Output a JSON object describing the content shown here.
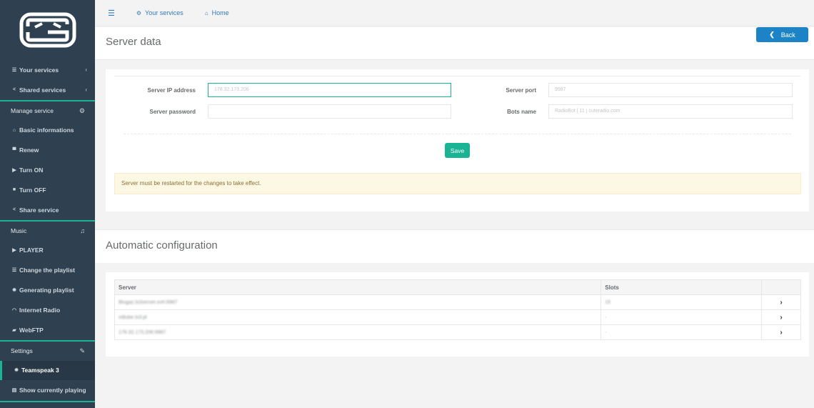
{
  "sidebar": {
    "items": [
      {
        "label": "Your services",
        "icon": "list-icon",
        "chevron": "‹"
      },
      {
        "label": "Shared services",
        "icon": "share-icon",
        "chevron": "‹"
      }
    ],
    "manage": {
      "header": "Manage service",
      "items": [
        {
          "label": "Basic informations",
          "icon": "home-icon"
        },
        {
          "label": "Renew",
          "icon": "cart-icon"
        },
        {
          "label": "Turn ON",
          "icon": "play-icon"
        },
        {
          "label": "Turn OFF",
          "icon": "stop-icon"
        },
        {
          "label": "Share service",
          "icon": "share-icon"
        }
      ]
    },
    "music": {
      "header": "Music",
      "items": [
        {
          "label": "PLAYER",
          "icon": "play-icon"
        },
        {
          "label": "Change the playlist",
          "icon": "list-icon"
        },
        {
          "label": "Generating playlist",
          "icon": "gear-icon"
        },
        {
          "label": "Internet Radio",
          "icon": "rss-icon"
        },
        {
          "label": "WebFTP",
          "icon": "folder-icon"
        }
      ]
    },
    "settings": {
      "header": "Settings",
      "items": [
        {
          "label": "Teamspeak 3",
          "icon": "gear-icon"
        },
        {
          "label": "Show currently playing",
          "icon": "file-icon"
        }
      ]
    }
  },
  "topbar": {
    "services": "Your services",
    "home": "Home"
  },
  "server_data": {
    "title": "Server data",
    "back": "Back",
    "ip_label": "Server IP address",
    "ip_value": "178.32.173.206",
    "port_label": "Server port",
    "port_value": "9987",
    "password_label": "Server password",
    "password_value": "",
    "bots_label": "Bots name",
    "bots_value": "RadioBot | 11 | cuteradio.com",
    "save": "Save",
    "alert": "Server must be restarted for the changes to take effect."
  },
  "auto_config": {
    "title": "Automatic configuration",
    "columns": [
      "Server",
      "Slots",
      ""
    ],
    "rows": [
      {
        "server": "Blugaz.ts3server.ovh:9987",
        "slots": "15"
      },
      {
        "server": "vdtube.ts3.pl",
        "slots": "-"
      },
      {
        "server": "178.32.173.206:9987",
        "slots": "-"
      }
    ]
  },
  "colors": {
    "sidebar_bg": "#2f4050",
    "accent": "#1ab394",
    "primary": "#1c84c6",
    "link": "#337ab7"
  }
}
